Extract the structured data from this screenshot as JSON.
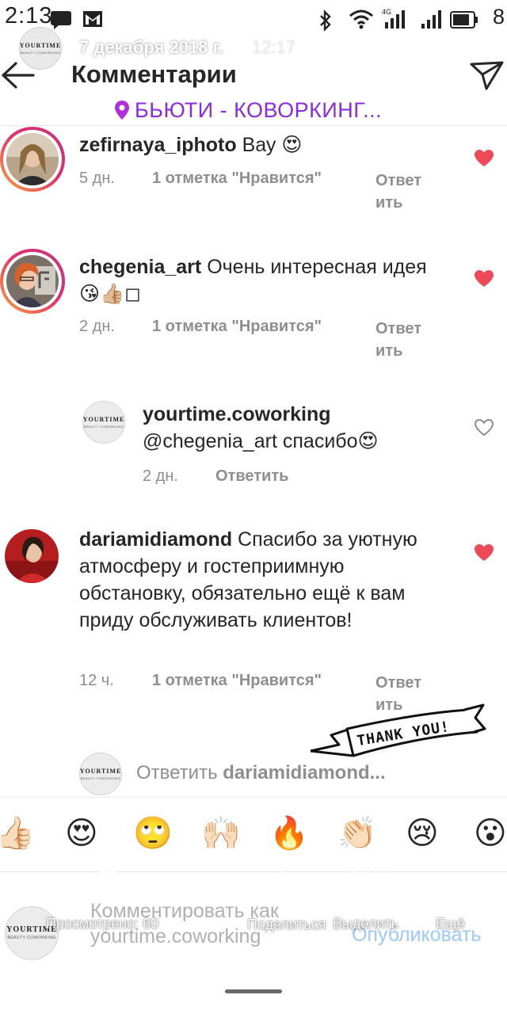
{
  "status_bar": {
    "time": "2:13",
    "battery": "8",
    "network": "4G"
  },
  "story_header": {
    "avatar_logo": "YOURTIME",
    "avatar_logo_sub": "BEAUTY COWORKING",
    "date": "7 декабря 2018 г.",
    "time": "12:17"
  },
  "header": {
    "title": "Комментарии"
  },
  "location": {
    "text": "БЬЮТИ - КОВОРКИНГ..."
  },
  "comments": [
    {
      "username": "zefirnaya_iphoto",
      "text": " Вау 😍",
      "time": "5 дн.",
      "likes": "1 отметка \"Нравится\"",
      "reply_line1": "Ответ",
      "reply_line2": "ить",
      "liked": true
    },
    {
      "username": "chegenia_art",
      "text": " Очень интересная идея 😘👍🏼◻",
      "time": "2 дн.",
      "likes": "1 отметка \"Нравится\"",
      "reply_line1": "Ответ",
      "reply_line2": "ить",
      "liked": true
    },
    {
      "username": "yourtime.coworking",
      "text": "@chegenia_art спасибо😍",
      "time": "2 дн.",
      "reply": "Ответить",
      "liked": false
    },
    {
      "username": "dariamidiamond",
      "text": " Спасибо за уютную атмосферу и гостеприимную обстановку, обязательно ещё к вам приду обслуживать клиентов!",
      "time": "12 ч.",
      "likes": "1 отметка \"Нравится\"",
      "reply_line1": "Ответ",
      "reply_line2": "ить",
      "liked": true
    }
  ],
  "sticker": {
    "text": "THANK YOU!"
  },
  "reply_box": {
    "prefix": "Ответить ",
    "username": "dariamidiamond..."
  },
  "emojis": [
    "👍🏻",
    "😍",
    "🙄",
    "🙌🏻",
    "🔥",
    "👏🏻",
    "😢",
    "😮"
  ],
  "comment_box": {
    "placeholder_line1": "Комментировать как",
    "placeholder_line2": "yourtime.coworking",
    "publish": "Опубликовать"
  },
  "story_actions": {
    "viewed": "Просмотрено: 60",
    "share": "Поделиться",
    "highlight": "Выделить",
    "more": "Ещё"
  },
  "colors": {
    "accent_purple": "#8a2be2",
    "like_red": "#ed4956",
    "link_blue": "#3897f0"
  }
}
